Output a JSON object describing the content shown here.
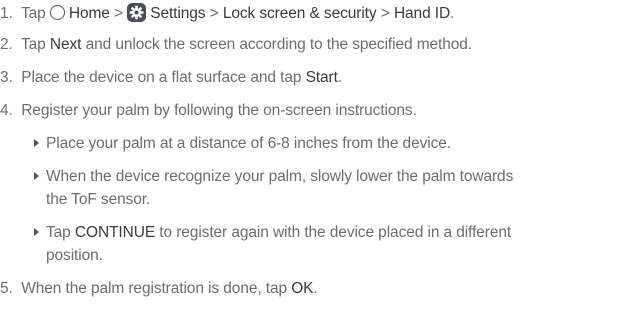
{
  "steps": [
    {
      "num": "1.",
      "text_a": "Tap",
      "home": "Home",
      "sep1": ">",
      "settings": "Settings",
      "sep2": ">",
      "lock": "Lock screen & security",
      "sep3": ">",
      "hand": "Hand ID",
      "end": "."
    },
    {
      "num": "2.",
      "text_a": "Tap",
      "bold": "Next",
      "text_b": "and unlock the screen according to the specified method."
    },
    {
      "num": "3.",
      "text_a": "Place the device on a flat surface and tap",
      "bold": "Start",
      "end": "."
    },
    {
      "num": "4.",
      "text_a": "Register your palm by following the on-screen instructions."
    },
    {
      "num": "5.",
      "text_a": "When the palm registration is done, tap",
      "bold": "OK",
      "end": "."
    }
  ],
  "bullets": [
    {
      "line1": "Place your palm at a distance of 6-8 inches from the device."
    },
    {
      "line1": "When the device recognize your palm, slowly lower the palm towards",
      "line2": "the ToF sensor."
    },
    {
      "line1_a": "Tap",
      "bold": "CONTINUE",
      "line1_b": "to register again with the device placed in a different",
      "line2": "position."
    }
  ],
  "icons": {
    "home": "home-circle-icon",
    "settings": "settings-gear-icon",
    "bullet": "triangle-bullet-icon"
  },
  "colors": {
    "text": "#6d6d6d",
    "emphasis": "#3a3a3a",
    "settings_icon_bg": "#4b4f55"
  }
}
